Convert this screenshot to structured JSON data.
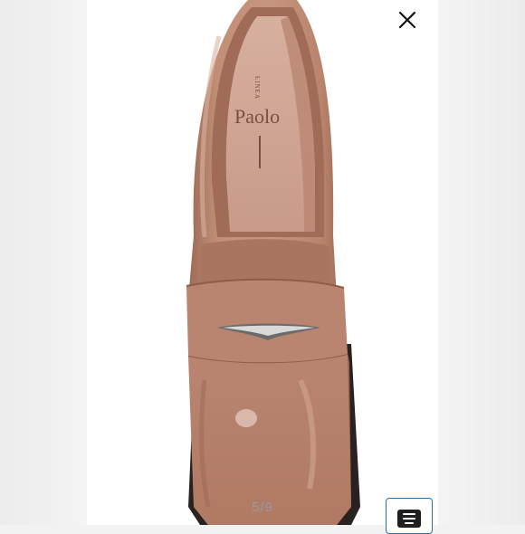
{
  "viewer": {
    "counter": "5/9",
    "close_icon": "close-icon",
    "details_icon": "details-icon"
  },
  "photo": {
    "brand_top": "LINEA",
    "brand_main": "Paolo"
  },
  "colors": {
    "shoe_body": "#b8846c",
    "shoe_shadow": "#8e5d48",
    "shoe_highlight": "#dcb6a3",
    "sole": "#2a2220",
    "background": "#f2f2f2"
  }
}
